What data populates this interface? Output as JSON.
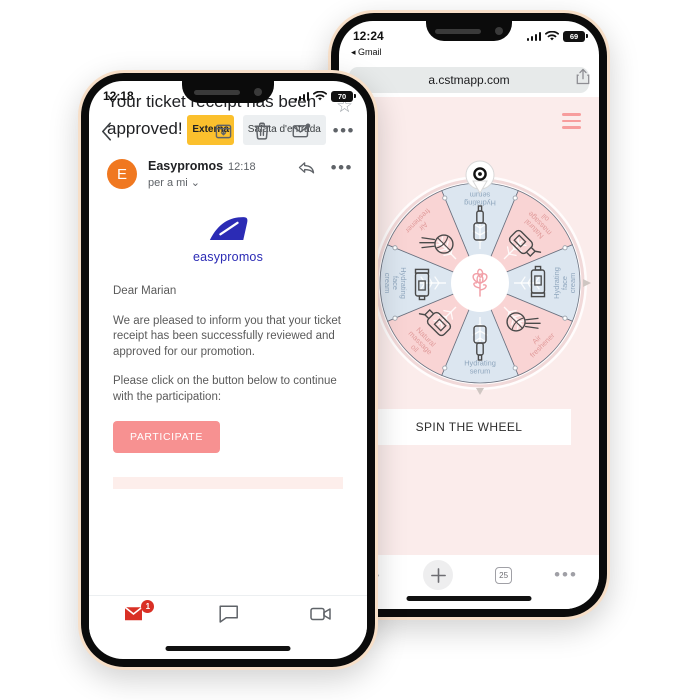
{
  "left_phone": {
    "status": {
      "time": "12:18",
      "battery": "70"
    },
    "toolbar": {
      "back_label": "Back",
      "archive_label": "Archive",
      "delete_label": "Delete",
      "unread_label": "Mark as unread",
      "more_label": "More options"
    },
    "email": {
      "subject": "Your ticket receipt has been approved!",
      "chip_external": "Externa",
      "chip_inbox": "Safata d'entrada",
      "star_label": "Star",
      "avatar_letter": "E",
      "sender": "Easypromos",
      "sent_time": "12:18",
      "recipient": "per a mi",
      "reply_label": "Reply",
      "more_label": "More",
      "logo_text": "easypromos",
      "greeting": "Dear Marian",
      "paragraph1": "We are pleased to inform you that your ticket receipt has been successfully reviewed and approved for our promotion.",
      "paragraph2": "Please click on the button below to continue with the participation:",
      "cta_label": "PARTICIPATE"
    },
    "bottom_nav": [
      {
        "name": "mail",
        "label": "Mail",
        "badge": "1"
      },
      {
        "name": "chat",
        "label": "Chat",
        "badge": ""
      },
      {
        "name": "meet",
        "label": "Meet",
        "badge": ""
      }
    ]
  },
  "right_phone": {
    "status": {
      "time": "12:24",
      "battery": "69"
    },
    "back_to_app": "Gmail",
    "browser": {
      "url": "a.cstmapp.com",
      "share_label": "Share",
      "forward_label": "Forward",
      "new_tab_label": "New Tab",
      "tab_count": "25",
      "more_label": "More"
    },
    "page": {
      "menu_label": "Menu",
      "spin_button": "SPIN THE WHEEL",
      "background_color": "#fbeceb",
      "accent_color": "#f79d9d",
      "segment_pink": "#f9d3d3",
      "segment_blue": "#d6e2ee"
    },
    "wheel": {
      "pointer_label": "Wheel pointer",
      "center_label": "Wheel hub",
      "segments": [
        {
          "label": "Hydrating serum",
          "color": "#dce6f0",
          "text_color": "#8fa6bd",
          "icon": "dropper-bottle-icon"
        },
        {
          "label": "Natural massage oil",
          "color": "#f9d4d4",
          "text_color": "#e09a9a",
          "icon": "massage-oil-bottle-icon"
        },
        {
          "label": "Hydrating face cream",
          "color": "#dce6f0",
          "text_color": "#8fa6bd",
          "icon": "cream-tube-icon"
        },
        {
          "label": "Air freshener",
          "color": "#f9d4d4",
          "text_color": "#e09a9a",
          "icon": "diffuser-icon"
        },
        {
          "label": "Hydrating serum",
          "color": "#dce6f0",
          "text_color": "#8fa6bd",
          "icon": "dropper-bottle-icon"
        },
        {
          "label": "Natural massage oil",
          "color": "#f9d4d4",
          "text_color": "#e09a9a",
          "icon": "massage-oil-bottle-icon"
        },
        {
          "label": "Hydrating face cream",
          "color": "#dce6f0",
          "text_color": "#8fa6bd",
          "icon": "cream-tube-icon"
        },
        {
          "label": "Air freshener",
          "color": "#f9d4d4",
          "text_color": "#e09a9a",
          "icon": "diffuser-icon"
        }
      ]
    }
  }
}
